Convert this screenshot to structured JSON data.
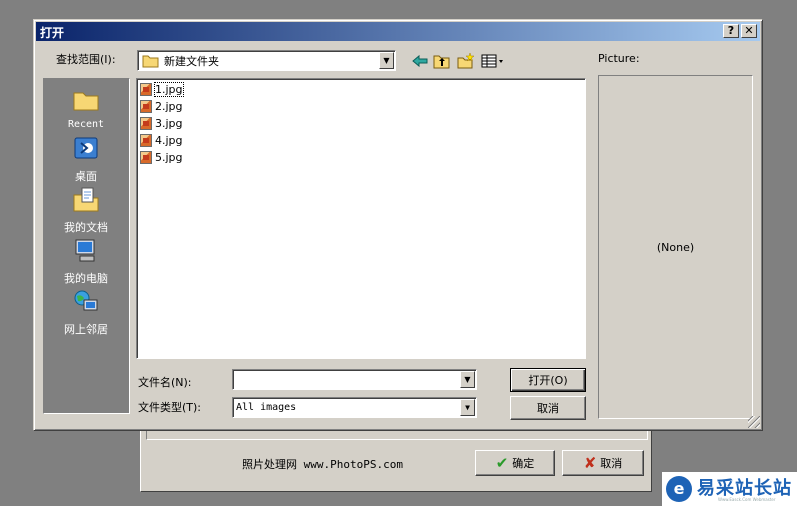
{
  "dialog": {
    "title": "打开",
    "help_glyph": "?",
    "close_glyph": "✕",
    "look_in_label": "查找范围(I):",
    "look_in_value": "新建文件夹",
    "places": [
      {
        "label": "Recent",
        "icon": "recent-folder-icon"
      },
      {
        "label": "桌面",
        "icon": "desktop-icon"
      },
      {
        "label": "我的文档",
        "icon": "my-documents-icon"
      },
      {
        "label": "我的电脑",
        "icon": "my-computer-icon"
      },
      {
        "label": "网上邻居",
        "icon": "network-places-icon"
      }
    ],
    "files": [
      "1.jpg",
      "2.jpg",
      "3.jpg",
      "4.jpg",
      "5.jpg"
    ],
    "filename_label": "文件名(N):",
    "filename_value": "",
    "filetype_label": "文件类型(T):",
    "filetype_value": "All images",
    "open_button": "打开(O)",
    "cancel_button": "取消",
    "picture_label": "Picture:",
    "preview_text": "(None)"
  },
  "background_window": {
    "label": "照片处理网 www.PhotoPS.com",
    "ok_button": "确定",
    "cancel_button": "取消"
  },
  "watermark": {
    "text": "易采站长站",
    "sub": "Www.Easck.Com Webmaster"
  }
}
